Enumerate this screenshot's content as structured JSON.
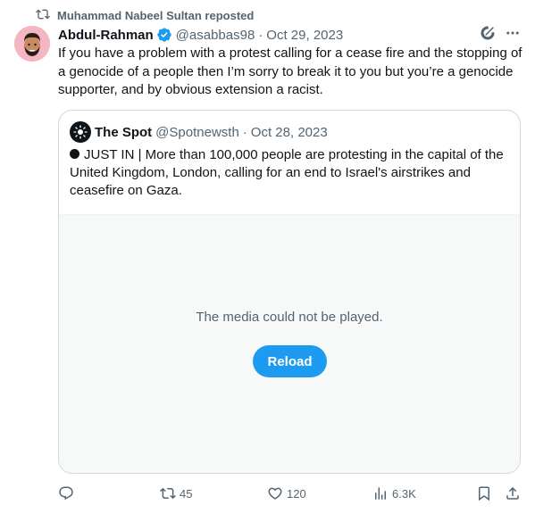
{
  "repost": {
    "text": "Muhammad Nabeel Sultan reposted",
    "icon": "repost-icon"
  },
  "tweet": {
    "author_name": "Abdul-Rahman",
    "handle": "@asabbas98",
    "separator": "·",
    "date": "Oct 29, 2023",
    "text": "If you have a problem with a protest calling for a cease fire and the stopping of a genocide of a people then I’m sorry to break it to you but you’re a genocide supporter, and by obvious extension a racist."
  },
  "quote": {
    "author_name": "The Spot",
    "handle": "@Spotnewsth",
    "separator": "·",
    "date": "Oct 28, 2023",
    "text": "JUST IN | More than 100,000 people are protesting in the capital of the United Kingdom, London, calling for an end to Israel's airstrikes and ceasefire on Gaza.",
    "media_message": "The media could not be played.",
    "reload_label": "Reload"
  },
  "actions": {
    "reply_count": "",
    "repost_count": "45",
    "like_count": "120",
    "views_count": "6.3K"
  },
  "colors": {
    "accent": "#1d9bf0",
    "muted": "#536471",
    "text": "#0f1419",
    "border": "#cfd9de"
  }
}
